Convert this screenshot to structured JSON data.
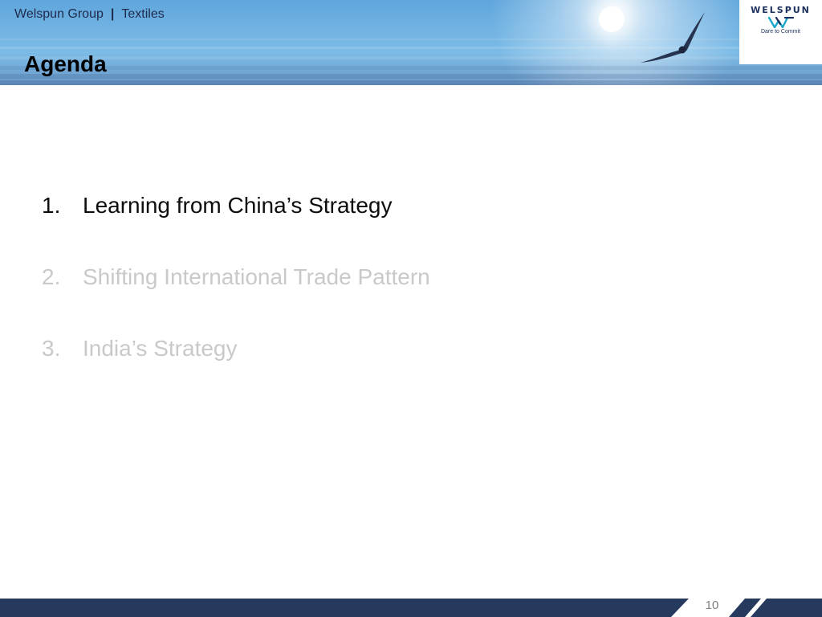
{
  "header": {
    "company": "Welspun Group",
    "separator": "|",
    "division": "Textiles",
    "title": "Agenda"
  },
  "logo": {
    "brand": "WELSPUN",
    "tagline": "Dare to Commit",
    "icon": "welspun-w-mark-icon",
    "color": "#1b2f5c",
    "accent_color": "#1aa6c9"
  },
  "agenda": {
    "items": [
      {
        "number": "1.",
        "label": "Learning from China’s Strategy",
        "state": "active"
      },
      {
        "number": "2.",
        "label": "Shifting International Trade Pattern",
        "state": "inactive"
      },
      {
        "number": "3.",
        "label": "India’s Strategy",
        "state": "inactive"
      }
    ]
  },
  "footer": {
    "page_number": "10",
    "bar_color": "#263a5e"
  },
  "colors": {
    "active_text": "#0d0d0d",
    "inactive_text": "#c9c9c9",
    "title_text": "#000000"
  }
}
